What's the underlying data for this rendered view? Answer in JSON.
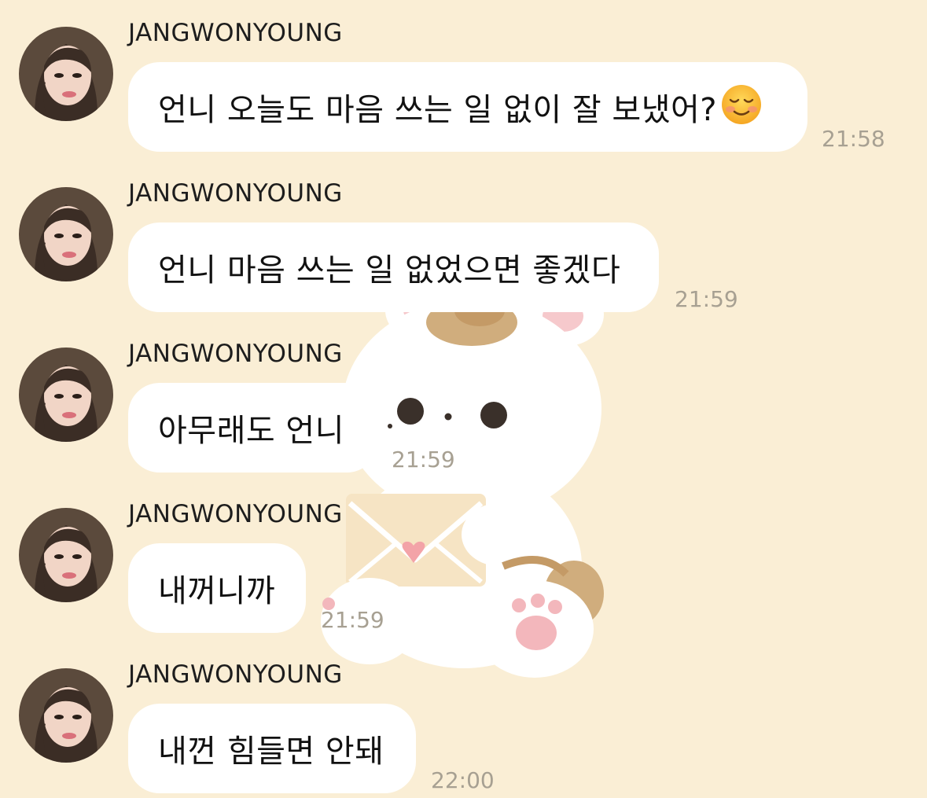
{
  "chat": {
    "messages": [
      {
        "sender": "JANGWONYOUNG",
        "text": "언니 오늘도 마음 쓰는 일 없이 잘 보냈어?",
        "emoji": "smiling-face-icon",
        "time": "21:58"
      },
      {
        "sender": "JANGWONYOUNG",
        "text": "언니 마음 쓰는 일 없었으면 좋겠다",
        "time": "21:59"
      },
      {
        "sender": "JANGWONYOUNG",
        "text": "아무래도 언니",
        "time": "21:59"
      },
      {
        "sender": "JANGWONYOUNG",
        "text": "내꺼니까",
        "time": "21:59"
      },
      {
        "sender": "JANGWONYOUNG",
        "text": "내껀 힘들면 안돼",
        "time": "22:00"
      }
    ]
  },
  "theme": {
    "background": "#faeed5",
    "bubble": "#ffffff",
    "timestamp": "#a7a092"
  },
  "wallpaper": {
    "illustration": "bunny-with-letter-icon"
  }
}
